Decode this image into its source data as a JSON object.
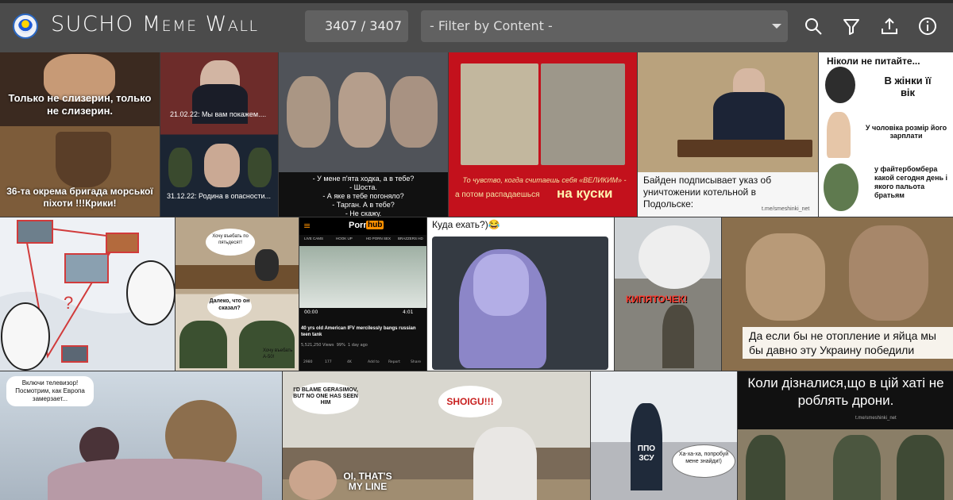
{
  "header": {
    "title": "SUCHO Meme Wall",
    "counter": "3407 / 3407",
    "filter_placeholder": "- Filter by Content -",
    "icons": [
      "search-icon",
      "filter-icon",
      "upload-icon",
      "info-icon"
    ]
  },
  "memes": {
    "m1": {
      "top": "Только не слизерин, только не слизерин.",
      "bottom": "36-та окрема бригада морської піхоти !!!Крики!"
    },
    "m2": {
      "top": "21.02.22: Мы вам покажем....",
      "bottom": "31.12.22: Родина в опасности..."
    },
    "m3": {
      "lines": [
        "- У мене п'ята ходка, а в тебе?",
        "- Шоста.",
        "- А яке в тебе погоняло?",
        "- Тарган. А в тебе?",
        "- Не скажу."
      ]
    },
    "m4": {
      "caption1": "То чувство, когда считаешь себя «ВЕЛИКИМ» -",
      "caption2": "а потом распадаешься",
      "caption3": "на куски"
    },
    "m5": {
      "caption": "Байден подписывает указ об уничтожении котельной в Подольске:",
      "credit": "t.me/smeshinki_net"
    },
    "m6": {
      "title": "Ніколи не питайте...",
      "line1": "В жінки її вік",
      "line2": "У чоловіка розмір його зарплати",
      "line3": "у файтербомбера какой сегодня день і якого пальота братьям"
    },
    "m8": {
      "bubble1": "Хочу въебать по пятьдесят!",
      "bubble2": "Далеко, что он сказал?",
      "bubble3": "Хочу въебать А-50!"
    },
    "m9": {
      "logo": "Porn",
      "logo2": "hub",
      "tabs": [
        "LIVE CAMS",
        "HOOK UP",
        "HD PORN SEX",
        "BRAZZERS HD"
      ],
      "time_left": "00:00",
      "time_right": "4:01",
      "video_title": "40 yrs old American IFV mercilessly bangs russian teen tank",
      "views": "5,521,250 Views",
      "rating": "99%",
      "age": "1 day ago",
      "actions": [
        "2980",
        "177",
        "4K",
        "Add to",
        "Report",
        "Share"
      ]
    },
    "m10": {
      "caption": "Куда ехать?)😂"
    },
    "m11": {
      "caption": "КИПЯТОЧЕК!"
    },
    "m12": {
      "caption": "Да если бы не отопление и яйца мы бы давно эту Украину победили"
    },
    "m13": {
      "bubble": "Включи телевизор! Посмотрим, как Европа замерзает..."
    },
    "m14": {
      "bubble1": "I'D BLAME GERASIMOV, BUT NO ONE HAS SEEN HIM",
      "bubble2": "SHOIGU!!!",
      "bubble3": "OI, THAT'S MY LINE"
    },
    "m15": {
      "label": "ППО ЗСУ",
      "bubble": "Ха-ха-ха, попробуй мене знайди!)"
    },
    "m16": {
      "caption": "Коли дізналися,що в цій хаті не роблять дрони.",
      "credit": "t.me/smeshinki_net"
    }
  }
}
